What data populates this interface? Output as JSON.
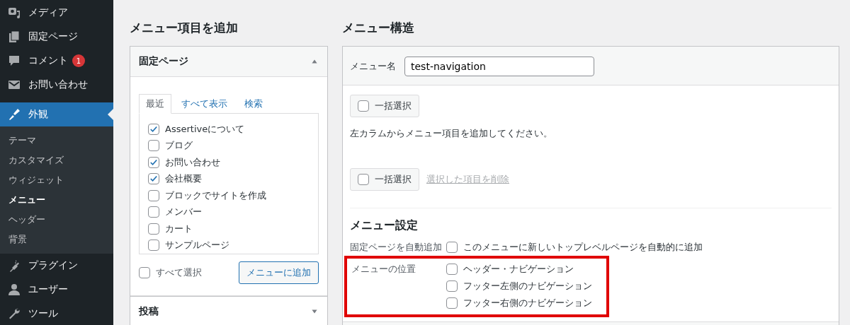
{
  "sidebar": {
    "items": [
      {
        "label": "メディア",
        "selected": false
      },
      {
        "label": "固定ページ",
        "selected": false
      },
      {
        "label": "コメント",
        "selected": false,
        "badge": "1"
      },
      {
        "label": "お問い合わせ",
        "selected": false
      },
      {
        "label": "外観",
        "selected": true,
        "submenu": [
          {
            "label": "テーマ",
            "selected": false
          },
          {
            "label": "カスタマイズ",
            "selected": false
          },
          {
            "label": "ウィジェット",
            "selected": false
          },
          {
            "label": "メニュー",
            "selected": true
          },
          {
            "label": "ヘッダー",
            "selected": false
          },
          {
            "label": "背景",
            "selected": false
          }
        ]
      },
      {
        "label": "プラグイン",
        "selected": false
      },
      {
        "label": "ユーザー",
        "selected": false
      },
      {
        "label": "ツール",
        "selected": false
      }
    ]
  },
  "add_items": {
    "title": "メニュー項目を追加",
    "panels": [
      {
        "title": "固定ページ",
        "expanded": true,
        "tabs": [
          {
            "label": "最近",
            "selected": true
          },
          {
            "label": "すべて表示",
            "selected": false
          },
          {
            "label": "検索",
            "selected": false
          }
        ],
        "items": [
          {
            "label": "Assertiveについて",
            "checked": true
          },
          {
            "label": "ブログ",
            "checked": false
          },
          {
            "label": "お問い合わせ",
            "checked": true
          },
          {
            "label": "会社概要",
            "checked": true
          },
          {
            "label": "ブロックでサイトを作成",
            "checked": false
          },
          {
            "label": "メンバー",
            "checked": false
          },
          {
            "label": "カート",
            "checked": false
          },
          {
            "label": "サンプルページ",
            "checked": false
          }
        ],
        "select_all": {
          "label": "すべて選択",
          "checked": false
        },
        "add_button": "メニューに追加"
      },
      {
        "title": "投稿",
        "expanded": false
      }
    ]
  },
  "menu_structure": {
    "title": "メニュー構造",
    "menu_name": {
      "label": "メニュー名",
      "value": "test-navigation"
    },
    "bulk_select_top": {
      "label": "一括選択",
      "checked": false
    },
    "instructions": "左カラムからメニュー項目を追加してください。",
    "bulk_select_bottom": {
      "label": "一括選択",
      "checked": false
    },
    "delete_link": "選択した項目を削除",
    "settings": {
      "title": "メニュー設定",
      "auto_add": {
        "label": "固定ページを自動追加",
        "option": "このメニューに新しいトップレベルページを自動的に追加",
        "checked": false
      },
      "locations": {
        "label": "メニューの位置",
        "highlighted": true,
        "options": [
          {
            "label": "ヘッダー・ナビゲーション",
            "checked": false
          },
          {
            "label": "フッター左側のナビゲーション",
            "checked": false
          },
          {
            "label": "フッター右側のナビゲーション",
            "checked": false
          }
        ]
      }
    }
  }
}
